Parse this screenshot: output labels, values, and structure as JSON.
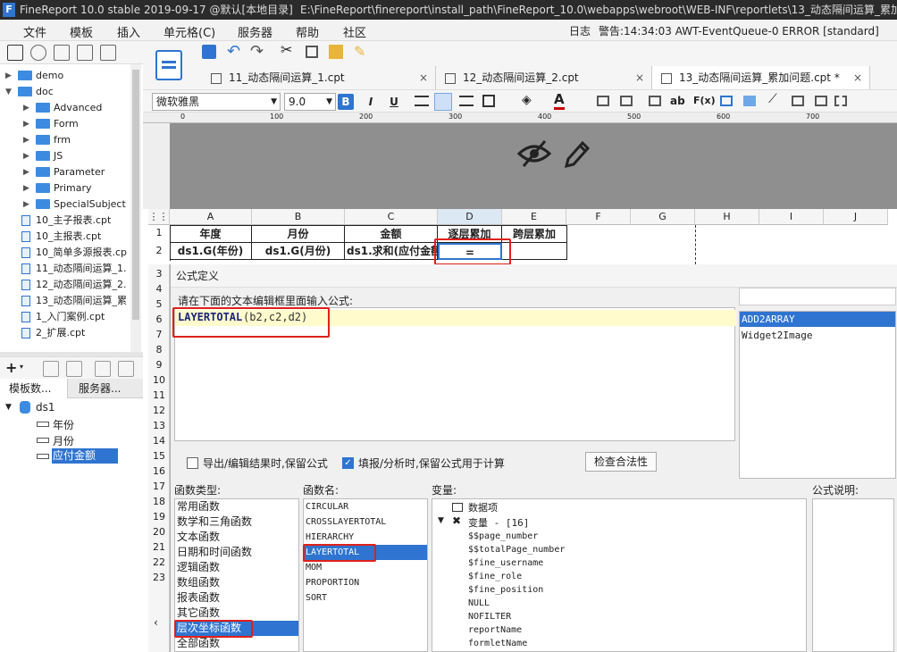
{
  "window": {
    "title": "FineReport 10.0 stable 2019-09-17 @默认[本地目录]",
    "path": "E:\\FineReport\\finereport\\install_path\\FineReport_10.0\\webapps\\webroot\\WEB-INF\\reportlets\\13_动态隔间运算_累加"
  },
  "menu": {
    "items": [
      "文件",
      "模板",
      "插入",
      "单元格(C)",
      "服务器",
      "帮助",
      "社区"
    ],
    "log_label": "日志",
    "warning": "警告:14:34:03 AWT-EventQueue-0 ERROR [standard]"
  },
  "tree": {
    "items": [
      {
        "label": "demo",
        "kind": "folder",
        "level": 0,
        "expander": "▶"
      },
      {
        "label": "doc",
        "kind": "folder",
        "level": 0,
        "expander": "▼"
      },
      {
        "label": "Advanced",
        "kind": "folder",
        "level": 1,
        "expander": "▶"
      },
      {
        "label": "Form",
        "kind": "folder",
        "level": 1,
        "expander": "▶"
      },
      {
        "label": "frm",
        "kind": "folder",
        "level": 1,
        "expander": "▶"
      },
      {
        "label": "JS",
        "kind": "folder",
        "level": 1,
        "expander": "▶"
      },
      {
        "label": "Parameter",
        "kind": "folder",
        "level": 1,
        "expander": "▶"
      },
      {
        "label": "Primary",
        "kind": "folder",
        "level": 1,
        "expander": "▶"
      },
      {
        "label": "SpecialSubject",
        "kind": "folder",
        "level": 1,
        "expander": "▶"
      },
      {
        "label": "10_主子报表.cpt",
        "kind": "file",
        "level": 0
      },
      {
        "label": "10_主报表.cpt",
        "kind": "file",
        "level": 0
      },
      {
        "label": "10_简单多源报表.cp",
        "kind": "file",
        "level": 0
      },
      {
        "label": "11_动态隔间运算_1.",
        "kind": "file",
        "level": 0
      },
      {
        "label": "12_动态隔间运算_2.",
        "kind": "file",
        "level": 0
      },
      {
        "label": "13_动态隔间运算_累",
        "kind": "file",
        "level": 0
      },
      {
        "label": "1_入门案例.cpt",
        "kind": "file",
        "level": 0
      },
      {
        "label": "2_扩展.cpt",
        "kind": "file",
        "level": 0
      }
    ]
  },
  "left_tabs": [
    "模板数...",
    "服务器..."
  ],
  "dataset": {
    "name": "ds1",
    "fields": [
      "年份",
      "月份",
      "应付金额"
    ],
    "selected_index": 2
  },
  "editor_tabs": [
    {
      "label": "11_动态隔间运算_1.cpt",
      "close": "×"
    },
    {
      "label": "12_动态隔间运算_2.cpt",
      "close": "×"
    },
    {
      "label": "13_动态隔间运算_累加问题.cpt *",
      "close": "×"
    }
  ],
  "format": {
    "font": "微软雅黑",
    "size": "9.0",
    "bold": "B",
    "italic": "I",
    "underline": "U",
    "ab": "ab",
    "fx": "F(x)"
  },
  "ruler": [
    "0",
    "100",
    "200",
    "300",
    "400",
    "500",
    "600",
    "700"
  ],
  "grid": {
    "columns": [
      "A",
      "B",
      "C",
      "D",
      "E",
      "F",
      "G",
      "H",
      "I",
      "J"
    ],
    "rows": [
      "1",
      "2",
      "3",
      "4",
      "5",
      "6",
      "7",
      "8",
      "9",
      "10",
      "11",
      "12",
      "13",
      "14",
      "15",
      "16",
      "17",
      "18",
      "19",
      "20",
      "21",
      "22",
      "23"
    ],
    "header_cells": [
      "年度",
      "月份",
      "金额",
      "逐层累加",
      "跨层累加"
    ],
    "data_cells": [
      "ds1.G(年份)",
      "ds1.G(月份)",
      "ds1.求和(应付金额",
      "=",
      ""
    ]
  },
  "dialog": {
    "title": "公式定义",
    "prompt": "请在下面的文本编辑框里面输入公式:",
    "formula_fn": "LAYERTOTAL",
    "formula_args": "(b2,c2,d2)",
    "search_value": "",
    "func_results": [
      "ADD2ARRAY",
      "Widget2Image"
    ],
    "opt_export": "导出/编辑结果时,保留公式",
    "opt_fill": "填报/分析时,保留公式用于计算",
    "check_button": "检查合法性",
    "func_type_label": "函数类型:",
    "func_name_label": "函数名:",
    "var_label": "变量:",
    "desc_label": "公式说明:",
    "func_types": [
      "常用函数",
      "数学和三角函数",
      "文本函数",
      "日期和时间函数",
      "逻辑函数",
      "数组函数",
      "报表函数",
      "其它函数",
      "层次坐标函数",
      "全部函数"
    ],
    "func_types_selected": 8,
    "func_names": [
      "CIRCULAR",
      "CROSSLAYERTOTAL",
      "HIERARCHY",
      "LAYERTOTAL",
      "MOM",
      "PROPORTION",
      "SORT"
    ],
    "func_names_selected": 3,
    "var_data_items": "数据项",
    "var_group": "变量 - [16]",
    "variables": [
      "$$page_number",
      "$$totalPage_number",
      "$fine_username",
      "$fine_role",
      "$fine_position",
      "NULL",
      "NOFILTER",
      "reportName",
      "formletName"
    ]
  }
}
